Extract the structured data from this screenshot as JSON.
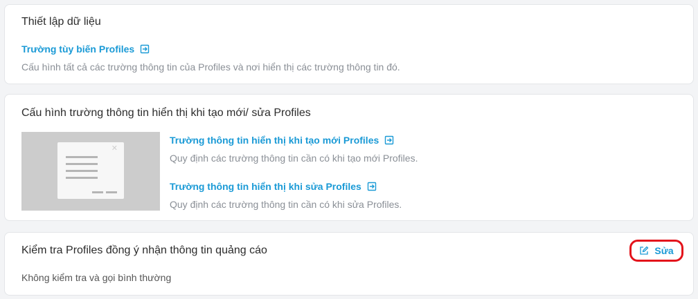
{
  "data_setup": {
    "title": "Thiết lập dữ liệu",
    "custom_fields_link": "Trường tùy biến Profiles",
    "custom_fields_desc": "Cấu hình tất cả các trường thông tin của Profiles và nơi hiển thị các trường thông tin đó."
  },
  "display_config": {
    "title": "Cấu hình trường thông tin hiển thị khi tạo mới/ sửa Profiles",
    "create_link": "Trường thông tin hiển thị khi tạo mới Profiles",
    "create_desc": "Quy định các trường thông tin cần có khi tạo mới Profiles.",
    "edit_link": "Trường thông tin hiển thị khi sửa Profiles",
    "edit_desc": "Quy định các trường thông tin cần có khi sửa Profiles."
  },
  "consent_check": {
    "title": "Kiểm tra Profiles đồng ý nhận thông tin quảng cáo",
    "edit_label": "Sửa",
    "status": "Không kiểm tra và gọi bình thường"
  },
  "colors": {
    "link": "#1a9ad6",
    "highlight": "#e3131b"
  },
  "icons": {
    "open": "open-link-icon",
    "edit": "edit-icon",
    "close": "close-icon"
  }
}
